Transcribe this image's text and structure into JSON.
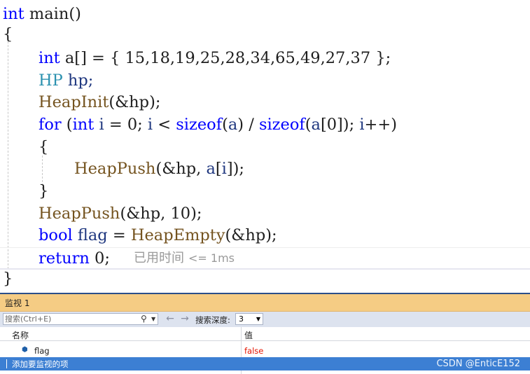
{
  "code": {
    "line1": {
      "type": "int",
      "rest": " main()"
    },
    "line2": "{",
    "line3": {
      "type": "int",
      "decl": " a[] = { ",
      "values": "15,18,19,25,28,34,65,49,27,37",
      "end": " };"
    },
    "line4": {
      "type": "HP",
      "rest": " hp;"
    },
    "line5": {
      "fn": "HeapInit",
      "rest": "(&hp);"
    },
    "line6": {
      "kw_for": "for",
      "p1": " (",
      "type": "int",
      "v1": " i",
      "p2": " = 0; ",
      "v2": "i",
      "p3": " < ",
      "sizeof1": "sizeof",
      "p4": "(",
      "v3": "a",
      "p5": ") / ",
      "sizeof2": "sizeof",
      "p6": "(",
      "v4": "a",
      "p7": "[0]); ",
      "v5": "i",
      "p8": "++)"
    },
    "line7": "{",
    "line8": {
      "fn": "HeapPush",
      "p1": "(&hp, ",
      "v1": "a",
      "p2": "[",
      "v2": "i",
      "p3": "]);"
    },
    "line9": "}",
    "line10": {
      "fn": "HeapPush",
      "rest": "(&hp, 10);"
    },
    "line11": {
      "type": "bool",
      "var": " flag",
      "p1": " = ",
      "fn": "HeapEmpty",
      "rest": "(&hp);"
    },
    "line12": {
      "kw": "return",
      "rest": " 0;"
    },
    "line13": "}",
    "elapsed_label": "已用时间",
    "elapsed_value": "<= 1ms"
  },
  "watch": {
    "title": "监视 1",
    "search_placeholder": "搜索(Ctrl+E)",
    "search_icon": "search-icon",
    "back_icon": "←",
    "forward_icon": "→",
    "depth_label": "搜索深度:",
    "depth_value": "3",
    "col_name": "名称",
    "col_value": "值",
    "rows": [
      {
        "name": "flag",
        "value": "false",
        "value_color": "#e51400"
      }
    ],
    "add_item_label": "添加要监视的项"
  },
  "watermark": "CSDN @EnticE152",
  "colors": {
    "keyword": "#0000ff",
    "type": "#2b91af",
    "function": "#74531f",
    "variable": "#1f377f",
    "watch_title_bg": "#f5cc84",
    "selection": "#3c7fd3"
  }
}
